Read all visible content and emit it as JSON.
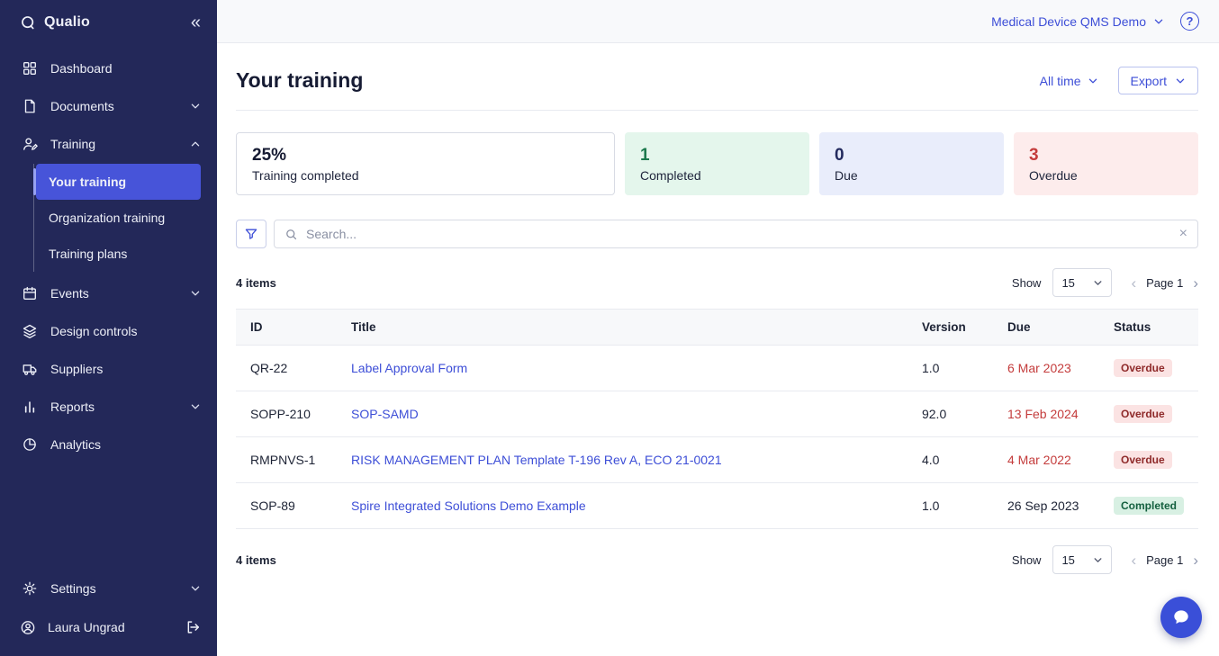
{
  "colors": {
    "accent": "#3D4ED7",
    "sidebar_bg": "#232859",
    "sidebar_active_bg": "#4754D9",
    "overdue_text": "#C43C3C",
    "overdue_pill_bg": "#FBE3E3",
    "overdue_pill_text": "#8F2A2A",
    "completed_pill_bg": "#D8F0E3",
    "completed_pill_text": "#14603F",
    "stat_green_bg": "#E4F6EC",
    "stat_blue_bg": "#E9EDFB",
    "stat_red_bg": "#FDECEC"
  },
  "icons": {
    "collapse": "«",
    "help": "?",
    "clear": "×",
    "page_prev": "‹",
    "page_next": "›"
  },
  "sidebar": {
    "brand": "Qualio",
    "items": [
      {
        "label": "Dashboard"
      },
      {
        "label": "Documents",
        "chevron": "down"
      },
      {
        "label": "Training",
        "chevron": "up",
        "children": [
          {
            "label": "Your training",
            "active": true
          },
          {
            "label": "Organization training"
          },
          {
            "label": "Training plans"
          }
        ]
      },
      {
        "label": "Events",
        "chevron": "down"
      },
      {
        "label": "Design controls"
      },
      {
        "label": "Suppliers"
      },
      {
        "label": "Reports",
        "chevron": "down"
      },
      {
        "label": "Analytics"
      }
    ],
    "bottom": [
      {
        "label": "Settings",
        "chevron": "down"
      },
      {
        "label": "Laura Ungrad"
      }
    ]
  },
  "topbar": {
    "workspace": "Medical Device QMS Demo"
  },
  "page": {
    "title": "Your training",
    "time_filter": "All time",
    "export_label": "Export"
  },
  "stats": [
    {
      "value": "25%",
      "label": "Training completed",
      "variant": "plain"
    },
    {
      "value": "1",
      "label": "Completed",
      "variant": "green"
    },
    {
      "value": "0",
      "label": "Due",
      "variant": "blue"
    },
    {
      "value": "3",
      "label": "Overdue",
      "variant": "red"
    }
  ],
  "search": {
    "placeholder": "Search..."
  },
  "table": {
    "items_count": "4 items",
    "show_label": "Show",
    "page_size": "15",
    "page_label": "Page 1",
    "columns": [
      "ID",
      "Title",
      "Version",
      "Due",
      "Status"
    ],
    "rows": [
      {
        "id": "QR-22",
        "title": "Label Approval Form",
        "version": "1.0",
        "due": "6 Mar 2023",
        "due_variant": "red",
        "status": "Overdue",
        "status_variant": "overdue"
      },
      {
        "id": "SOPP-210",
        "title": "SOP-SAMD",
        "version": "92.0",
        "due": "13 Feb 2024",
        "due_variant": "red",
        "status": "Overdue",
        "status_variant": "overdue"
      },
      {
        "id": "RMPNVS-1",
        "title": "RISK MANAGEMENT PLAN Template T-196 Rev A, ECO 21-0021",
        "version": "4.0",
        "due": "4 Mar 2022",
        "due_variant": "red",
        "status": "Overdue",
        "status_variant": "overdue"
      },
      {
        "id": "SOP-89",
        "title": "Spire Integrated Solutions Demo Example",
        "version": "1.0",
        "due": "26 Sep 2023",
        "due_variant": "normal",
        "status": "Completed",
        "status_variant": "completed"
      }
    ]
  }
}
